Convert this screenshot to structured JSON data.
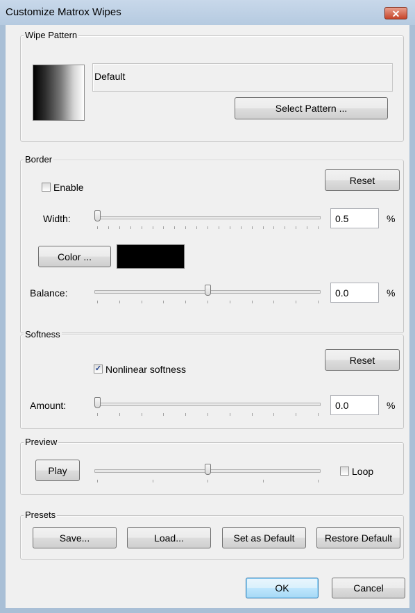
{
  "window": {
    "title": "Customize Matrox Wipes",
    "close_glyph": "✕"
  },
  "wipe_pattern": {
    "legend": "Wipe Pattern",
    "pattern_name": "Default",
    "select_button": "Select Pattern ..."
  },
  "border": {
    "legend": "Border",
    "enable_label": "Enable",
    "enable_checked": false,
    "reset_button": "Reset",
    "width_label": "Width:",
    "width_value": "0.5",
    "width_unit": "%",
    "width_slider_fraction": 0.0,
    "color_button": "Color ...",
    "color_swatch": "#000000",
    "balance_label": "Balance:",
    "balance_value": "0.0",
    "balance_unit": "%",
    "balance_slider_fraction": 0.5
  },
  "softness": {
    "legend": "Softness",
    "nonlinear_label": "Nonlinear softness",
    "nonlinear_checked": true,
    "check_glyph": "✓",
    "reset_button": "Reset",
    "amount_label": "Amount:",
    "amount_value": "0.0",
    "amount_unit": "%",
    "amount_slider_fraction": 0.0
  },
  "preview": {
    "legend": "Preview",
    "play_button": "Play",
    "slider_fraction": 0.5,
    "loop_label": "Loop",
    "loop_checked": false
  },
  "presets": {
    "legend": "Presets",
    "save_button": "Save...",
    "load_button": "Load...",
    "set_default_button": "Set as Default",
    "restore_default_button": "Restore Default"
  },
  "footer": {
    "ok_button": "OK",
    "cancel_button": "Cancel"
  }
}
